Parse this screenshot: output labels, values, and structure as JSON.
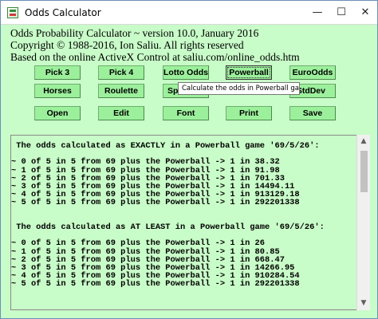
{
  "window": {
    "title": "Odds Calculator",
    "controls": {
      "minimize": "—",
      "maximize": "☐",
      "close": "✕"
    }
  },
  "header": {
    "line1": "Odds Probability Calculator ~ version 10.0, January 2016",
    "line2": "Copyright © 1988-2016, Ion Saliu. All rights reserved",
    "line3": "Based on the online ActiveX Control at saliu.com/online_odds.htm"
  },
  "buttons": {
    "pick3": "Pick 3",
    "pick4": "Pick 4",
    "lotto_odds": "Lotto Odds",
    "powerball": "Powerball",
    "euroodds": "EuroOdds",
    "horses": "Horses",
    "roulette": "Roulette",
    "sports": "Spo",
    "stddev": "StdDev",
    "open": "Open",
    "edit": "Edit",
    "font": "Font",
    "print": "Print",
    "save": "Save"
  },
  "tooltip": "Calculate the odds in Powerball games",
  "output": {
    "lines": [
      " The odds calculated as EXACTLY in a Powerball game '69/5/26':",
      "",
      "~ 0 of 5 in 5 from 69 plus the Powerball -> 1 in 38.32",
      "~ 1 of 5 in 5 from 69 plus the Powerball -> 1 in 91.98",
      "~ 2 of 5 in 5 from 69 plus the Powerball -> 1 in 701.33",
      "~ 3 of 5 in 5 from 69 plus the Powerball -> 1 in 14494.11",
      "~ 4 of 5 in 5 from 69 plus the Powerball -> 1 in 913129.18",
      "~ 5 of 5 in 5 from 69 plus the Powerball -> 1 in 292201338",
      "",
      "",
      " The odds calculated as AT LEAST in a Powerball game '69/5/26':",
      "",
      "~ 0 of 5 in 5 from 69 plus the Powerball -> 1 in 26",
      "~ 1 of 5 in 5 from 69 plus the Powerball -> 1 in 80.85",
      "~ 2 of 5 in 5 from 69 plus the Powerball -> 1 in 668.47",
      "~ 3 of 5 in 5 from 69 plus the Powerball -> 1 in 14266.95",
      "~ 4 of 5 in 5 from 69 plus the Powerball -> 1 in 910284.54",
      "~ 5 of 5 in 5 from 69 plus the Powerball -> 1 in 292201338"
    ]
  },
  "scrollbar": {
    "up_icon": "▲",
    "down_icon": "▼"
  }
}
